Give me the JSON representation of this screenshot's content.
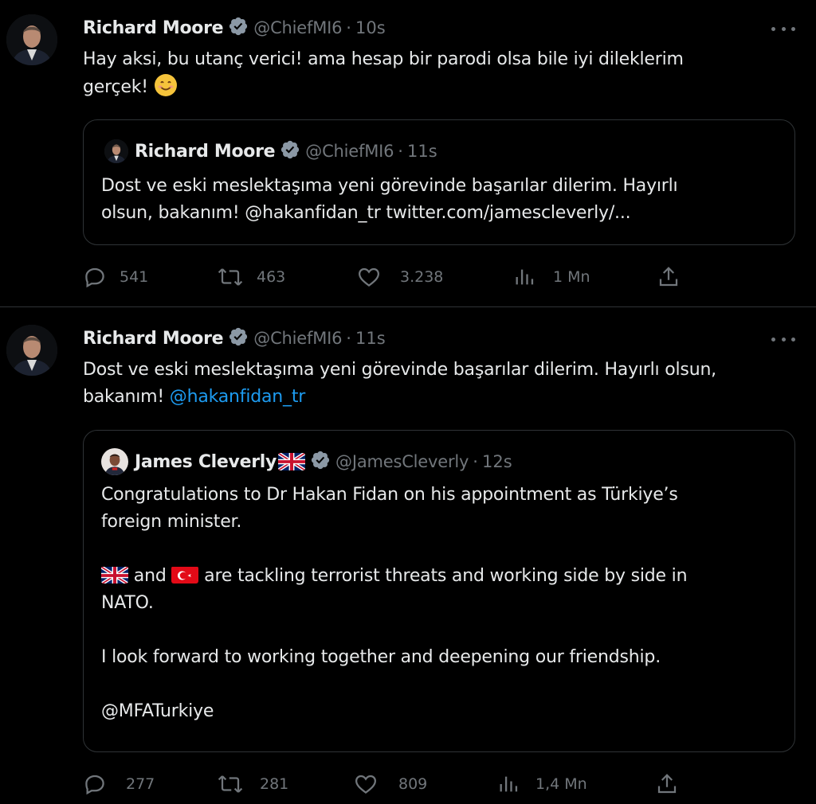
{
  "tweets": [
    {
      "author_name": "Richard Moore",
      "handle": "@ChiefMI6",
      "separator": "·",
      "time": "10s",
      "text_line1": "Hay aksi, bu utanç verici! ama hesap bir parodi olsa bile iyi dileklerim",
      "text_line2": "gerçek!",
      "quoted": {
        "author_name": "Richard Moore",
        "handle": "@ChiefMI6",
        "separator": "·",
        "time": "11s",
        "text_line1": "Dost ve eski meslektaşıma yeni görevinde başarılar dilerim.  Hayırlı",
        "text_line2": "olsun, bakanım! @hakanfidan_tr twitter.com/jamescleverly/..."
      },
      "stats": {
        "replies": "541",
        "retweets": "463",
        "likes": "3.238",
        "views": "1 Mn"
      }
    },
    {
      "author_name": "Richard Moore",
      "handle": "@ChiefMI6",
      "separator": "·",
      "time": "11s",
      "text_line1": "Dost ve eski meslektaşıma yeni görevinde başarılar dilerim.  Hayırlı olsun,",
      "text_line2_prefix": "bakanım! ",
      "text_line2_link": "@hakanfidan_tr",
      "quoted": {
        "author_name": "James Cleverly",
        "handle": "@JamesCleverly",
        "separator": "·",
        "time": "12s",
        "para1_line1": "Congratulations to Dr Hakan Fidan on his appointment as Türkiye’s",
        "para1_line2": "foreign minister.",
        "para2_and": " and ",
        "para2_line1_rest": " are tackling terrorist threats and working side by side in",
        "para2_line2": "NATO.",
        "para3": "I look forward to working together and deepening our friendship.",
        "para4": "@MFATurkiye"
      },
      "stats": {
        "replies": "277",
        "retweets": "281",
        "likes": "809",
        "views": "1,4 Mn"
      }
    }
  ],
  "colors": {
    "background": "#000000",
    "text": "#e7e9ea",
    "muted": "#71767b",
    "link": "#1d9bf0",
    "verified": "#8b98a5",
    "border": "#2f3336"
  },
  "icons": [
    "verified-badge-icon",
    "more-icon",
    "reply-icon",
    "retweet-icon",
    "like-icon",
    "views-icon",
    "share-icon",
    "smiling-face-emoji",
    "uk-flag-icon",
    "turkey-flag-icon"
  ]
}
